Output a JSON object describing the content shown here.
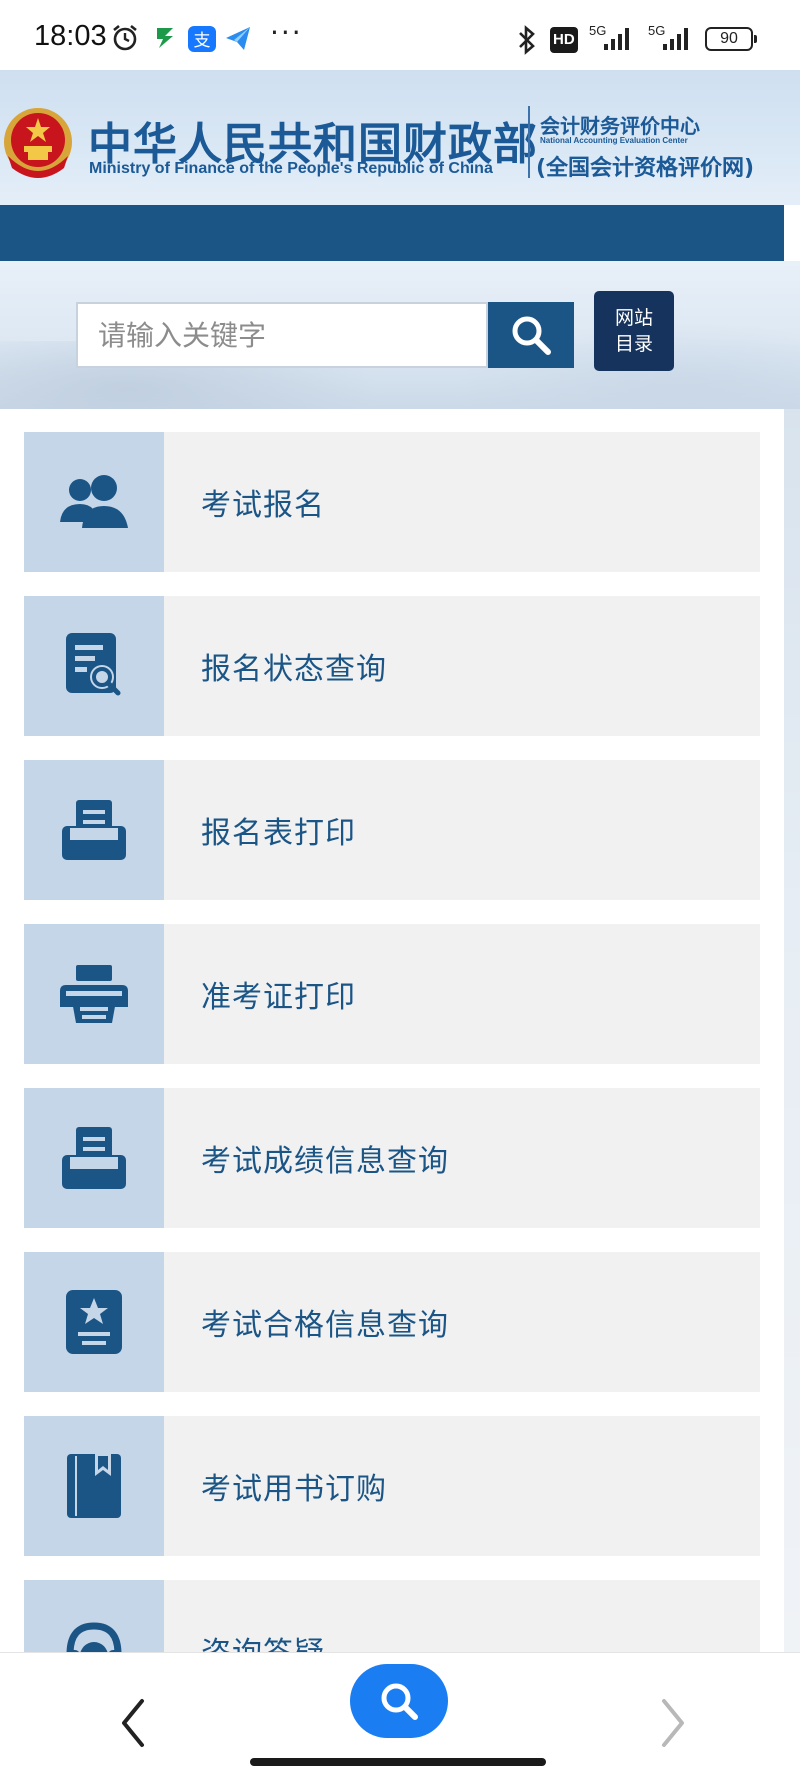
{
  "status_bar": {
    "time": "18:03",
    "network_label_1": "5G",
    "network_label_2": "5G",
    "hd_badge": "HD",
    "battery": "90",
    "more_indicator": "···"
  },
  "header": {
    "title": "中华人民共和国财政部",
    "subtitle": "Ministry of Finance of the People's Republic of China",
    "center_name": "会计财务评价中心",
    "center_english": "National Accounting Evaluation Center",
    "center_site": "(全国会计资格评价网)"
  },
  "search": {
    "placeholder": "请输入关键字",
    "sitemap_line1": "网站",
    "sitemap_line2": "目录"
  },
  "menu": {
    "items": [
      {
        "label": "考试报名",
        "icon": "users-icon"
      },
      {
        "label": "报名状态查询",
        "icon": "document-search-icon"
      },
      {
        "label": "报名表打印",
        "icon": "tray-print-icon"
      },
      {
        "label": "准考证打印",
        "icon": "printer-icon"
      },
      {
        "label": "考试成绩信息查询",
        "icon": "tray-doc-icon"
      },
      {
        "label": "考试合格信息查询",
        "icon": "certificate-icon"
      },
      {
        "label": "考试用书订购",
        "icon": "book-icon"
      },
      {
        "label": "咨询答疑",
        "icon": "headset-icon"
      }
    ]
  },
  "colors": {
    "brand_blue": "#1b5586",
    "menu_text": "#1b5586",
    "icon_bg": "#c4d6e8",
    "menu_bg": "#f1f1f2",
    "fab_blue": "#1a7ef2"
  }
}
